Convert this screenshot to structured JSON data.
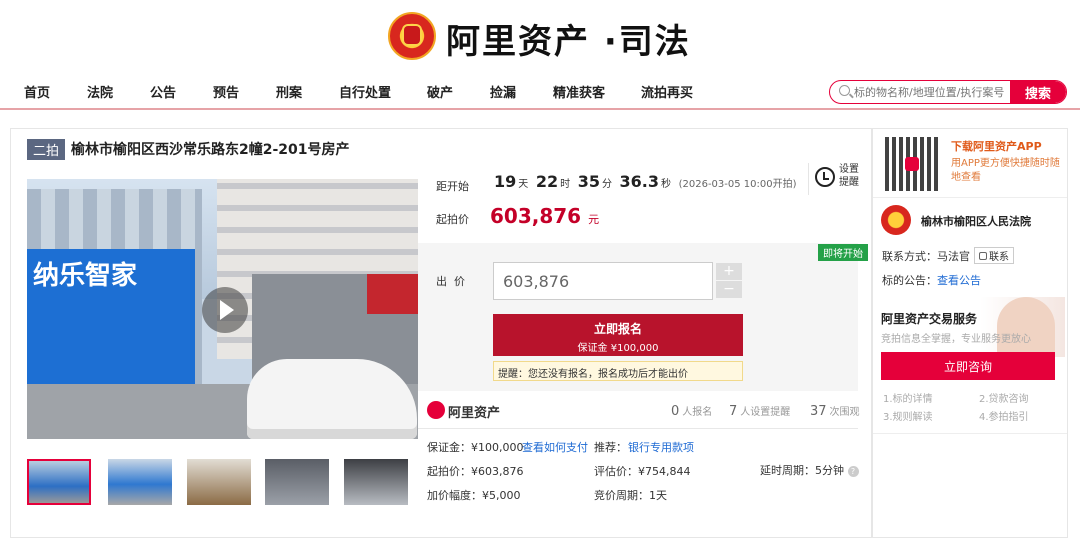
{
  "brand": {
    "title": "阿里资产 ·司法"
  },
  "nav": {
    "items": [
      "首页",
      "法院",
      "公告",
      "预告",
      "刑案",
      "自行处置",
      "破产",
      "捡漏",
      "精准获客",
      "流拍再买"
    ]
  },
  "search": {
    "placeholder": "标的物名称/地理位置/执行案号",
    "button": "搜索"
  },
  "item": {
    "round_tag": "二拍",
    "title": "榆林市榆阳区西沙常乐路东2幢2-201号房产",
    "shop_sign": "纳乐智家"
  },
  "auction": {
    "countdown_label": "距开始",
    "days": "19",
    "days_unit": "天",
    "hours": "22",
    "hours_unit": "时",
    "minutes": "35",
    "minutes_unit": "分",
    "seconds": "36.3",
    "seconds_unit": "秒",
    "start_time": "(2026-03-05 10:00开拍)",
    "remind_label": "设置\n提醒",
    "start_price_label": "起拍价",
    "start_price": "603,876",
    "start_price_unit": "元",
    "soon_badge": "即将开始",
    "bid_label": "出  价",
    "bid_value": "603,876",
    "plus": "+",
    "minus": "−",
    "apply_label": "立即报名",
    "deposit_note": "保证金 ¥100,000",
    "notice": "提醒：您还没有报名，报名成功后才能出价"
  },
  "platform": {
    "name": "阿里资产",
    "stats": [
      {
        "num": "0",
        "label": "人报名"
      },
      {
        "num": "7",
        "label": "人设置提醒"
      },
      {
        "num": "37",
        "label": "次围观"
      }
    ]
  },
  "details": {
    "deposit": "保证金：¥100,000",
    "pay_link": "查看如何支付",
    "recommend_label": "推荐：",
    "recommend_link": "银行专用款项",
    "start_price": "起拍价：¥603,876",
    "appraisal": "评估价：¥754,844",
    "delay": "延时周期：5分钟",
    "increment": "加价幅度：¥5,000",
    "cycle": "竞价周期：1天"
  },
  "sidebar": {
    "app_title": "下载阿里资产APP",
    "app_sub": "用APP更方便快捷随时随地查看",
    "court": "榆林市榆阳区人民法院",
    "contact_label": "联系方式：马法官",
    "contact_btn": "联系",
    "notice_label": "标的公告：",
    "notice_link": "查看公告",
    "service_title": "阿里资产交易服务",
    "service_sub": "竞拍信息全掌握，专业服务更放心",
    "consult_btn": "立即咨询",
    "links": [
      "1.标的详情",
      "2.贷款咨询",
      "3.规则解读",
      "4.参拍指引"
    ]
  },
  "colors": {
    "accent": "#e5003a",
    "price": "#c40028",
    "apply_button": "#b8132c",
    "soon": "#24a148"
  }
}
